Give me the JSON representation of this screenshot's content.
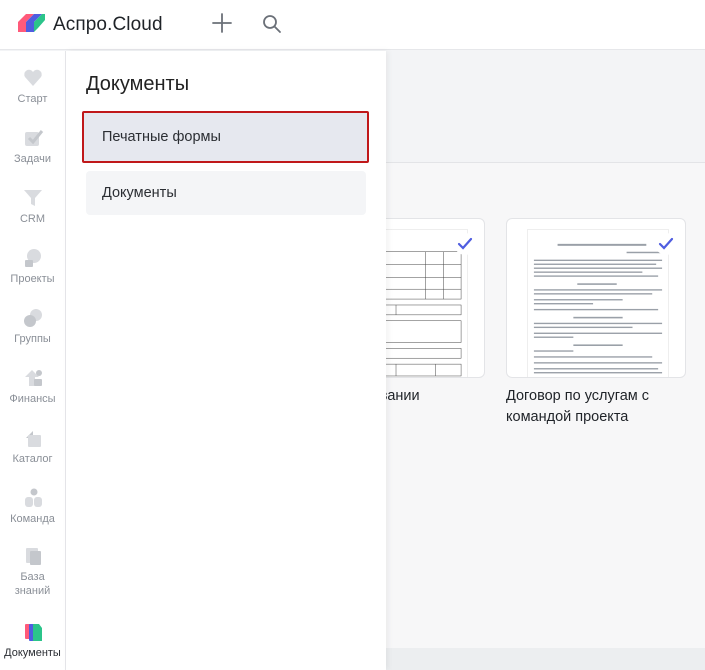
{
  "app": {
    "brand": "Аспро.Cloud"
  },
  "colors": {
    "accent": "#4f5de0",
    "highlight": "#c0181a",
    "brand_green": "#2bc48a",
    "brand_pink": "#ff5a7a"
  },
  "topbar": {
    "add_icon": "plus-icon",
    "search_icon": "search-icon"
  },
  "sidebar": {
    "items": [
      {
        "label": "Старт",
        "icon": "heart-icon"
      },
      {
        "label": "Задачи",
        "icon": "check-icon"
      },
      {
        "label": "CRM",
        "icon": "funnel-icon"
      },
      {
        "label": "Проекты",
        "icon": "project-icon"
      },
      {
        "label": "Группы",
        "icon": "groups-icon"
      },
      {
        "label": "Финансы",
        "icon": "finance-icon"
      },
      {
        "label": "Каталог",
        "icon": "catalog-icon"
      },
      {
        "label": "Команда",
        "icon": "team-icon"
      },
      {
        "label": "База знаний",
        "icon": "knowledge-icon"
      },
      {
        "label": "Документы",
        "icon": "documents-icon"
      }
    ]
  },
  "panel": {
    "title": "Документы",
    "items": [
      {
        "label": "Печатные формы"
      },
      {
        "label": "Документы"
      }
    ]
  },
  "templates": [
    {
      "title": "...оказании"
    },
    {
      "title": "Договор по услугам с командой проекта"
    }
  ]
}
